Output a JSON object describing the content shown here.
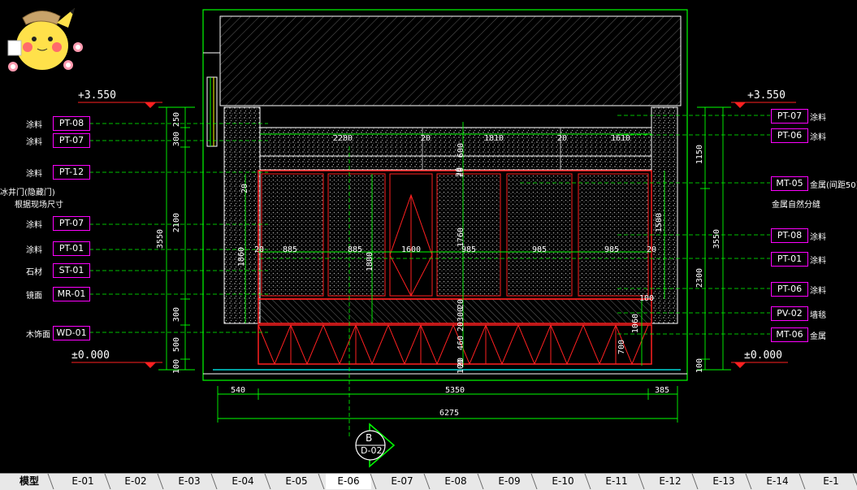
{
  "colors": {
    "background": "#000000",
    "dimension": "#00ff00",
    "tag_border": "#ff00ff",
    "tag_text": "#ffffff",
    "wall": "#ffffff",
    "cabinet": "#ff2020",
    "elevation_marker": "#ff2020",
    "section_marker": "#00ff00"
  },
  "elevations": {
    "top_left": "+3.550",
    "top_right": "+3.550",
    "bottom_left": "±0.000",
    "bottom_right": "±0.000"
  },
  "left_labels": [
    {
      "text": "涂料",
      "tag": "PT-08"
    },
    {
      "text": "涂料",
      "tag": "PT-07"
    },
    {
      "text": "涂料",
      "tag": "PT-12"
    },
    {
      "text": "冰井门(隐藏门)",
      "tag": ""
    },
    {
      "text": "根据现场尺寸",
      "tag": ""
    },
    {
      "text": "涂料",
      "tag": "PT-07"
    },
    {
      "text": "涂料",
      "tag": "PT-01"
    },
    {
      "text": "石材",
      "tag": "ST-01"
    },
    {
      "text": "镜面",
      "tag": "MR-01"
    },
    {
      "text": "木饰面",
      "tag": "WD-01"
    }
  ],
  "right_labels": [
    {
      "tag": "PT-07",
      "text": "涂料"
    },
    {
      "tag": "PT-06",
      "text": "涂料"
    },
    {
      "tag": "MT-05",
      "text": "金属(间距50)"
    },
    {
      "tag": "",
      "text": "金属自然分缝"
    },
    {
      "tag": "PT-08",
      "text": "涂料"
    },
    {
      "tag": "PT-01",
      "text": "涂料"
    },
    {
      "tag": "PT-06",
      "text": "涂料"
    },
    {
      "tag": "PV-02",
      "text": "墙毯"
    },
    {
      "tag": "MT-06",
      "text": "金属"
    }
  ],
  "left_dims": [
    "250",
    "300",
    "2100",
    "300",
    "500",
    "100"
  ],
  "left_total": "3550",
  "right_dims": [
    "1150",
    "2300",
    "100"
  ],
  "right_total": "3550",
  "inner_dims": {
    "top_row": [
      "2280",
      "20",
      "1810",
      "20",
      "1610"
    ],
    "panel_widths": [
      "885",
      "885",
      "1600",
      "985",
      "985",
      "985"
    ],
    "vertical": [
      "600",
      "20",
      "1760",
      "20",
      "300",
      "20",
      "460",
      "20",
      "100"
    ],
    "misc": [
      "1860",
      "1800",
      "1500",
      "1060",
      "700",
      "100",
      "20",
      "20",
      "20",
      "20"
    ]
  },
  "bottom_dims": {
    "segments": [
      "540",
      "5350",
      "385"
    ],
    "total": "6275"
  },
  "section_marker": {
    "letter": "B",
    "sheet": "D-02"
  },
  "tabs": [
    "模型",
    "E-01",
    "E-02",
    "E-03",
    "E-04",
    "E-05",
    "E-06",
    "E-07",
    "E-08",
    "E-09",
    "E-10",
    "E-11",
    "E-12",
    "E-13",
    "E-14",
    "E-1"
  ],
  "active_tab": "E-06"
}
